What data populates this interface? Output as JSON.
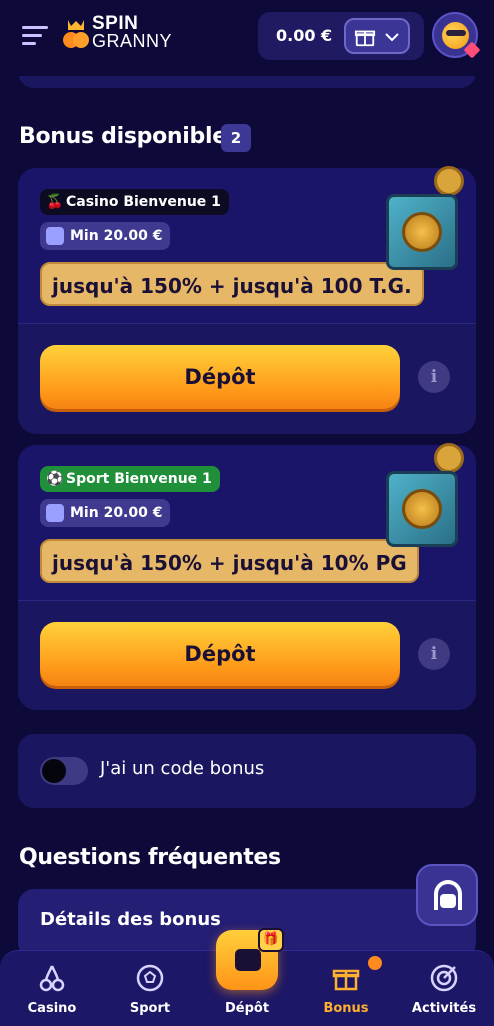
{
  "header": {
    "logo_line1": "SPIN",
    "logo_line2": "GRANNY",
    "balance": "0.00 €"
  },
  "bonus_section": {
    "title": "Bonus disponibles",
    "count": "2"
  },
  "bonuses": [
    {
      "tag": "Casino Bienvenue 1",
      "tag_icon": "cherry-icon",
      "min": "Min 20.00 €",
      "offer": "jusqu'à 150% + jusqu'à 100 T.G.",
      "button": "Dépôt",
      "info": "i"
    },
    {
      "tag": "Sport Bienvenue 1",
      "tag_icon": "soccer-ball-icon",
      "min": "Min 20.00 €",
      "offer": "jusqu'à 150% + jusqu'à 10% PG",
      "button": "Dépôt",
      "info": "i"
    }
  ],
  "bonus_code": {
    "label": "J'ai un code bonus",
    "enabled": false
  },
  "faq": {
    "title": "Questions fréquentes",
    "items": [
      "Détails des bonus"
    ]
  },
  "bottom_nav": {
    "items": [
      {
        "label": "Casino",
        "icon": "cherry-icon"
      },
      {
        "label": "Sport",
        "icon": "soccer-ball-icon"
      },
      {
        "label": "Dépôt",
        "icon": "wallet-icon"
      },
      {
        "label": "Bonus",
        "icon": "gift-icon",
        "active": true
      },
      {
        "label": "Activités",
        "icon": "target-icon"
      }
    ]
  },
  "colors": {
    "background": "#0d0a3a",
    "card": "#1b1660",
    "accent_orange": "#ff9a1a",
    "offer_gold": "#e5b766",
    "sport_green": "#1f8f3a"
  }
}
